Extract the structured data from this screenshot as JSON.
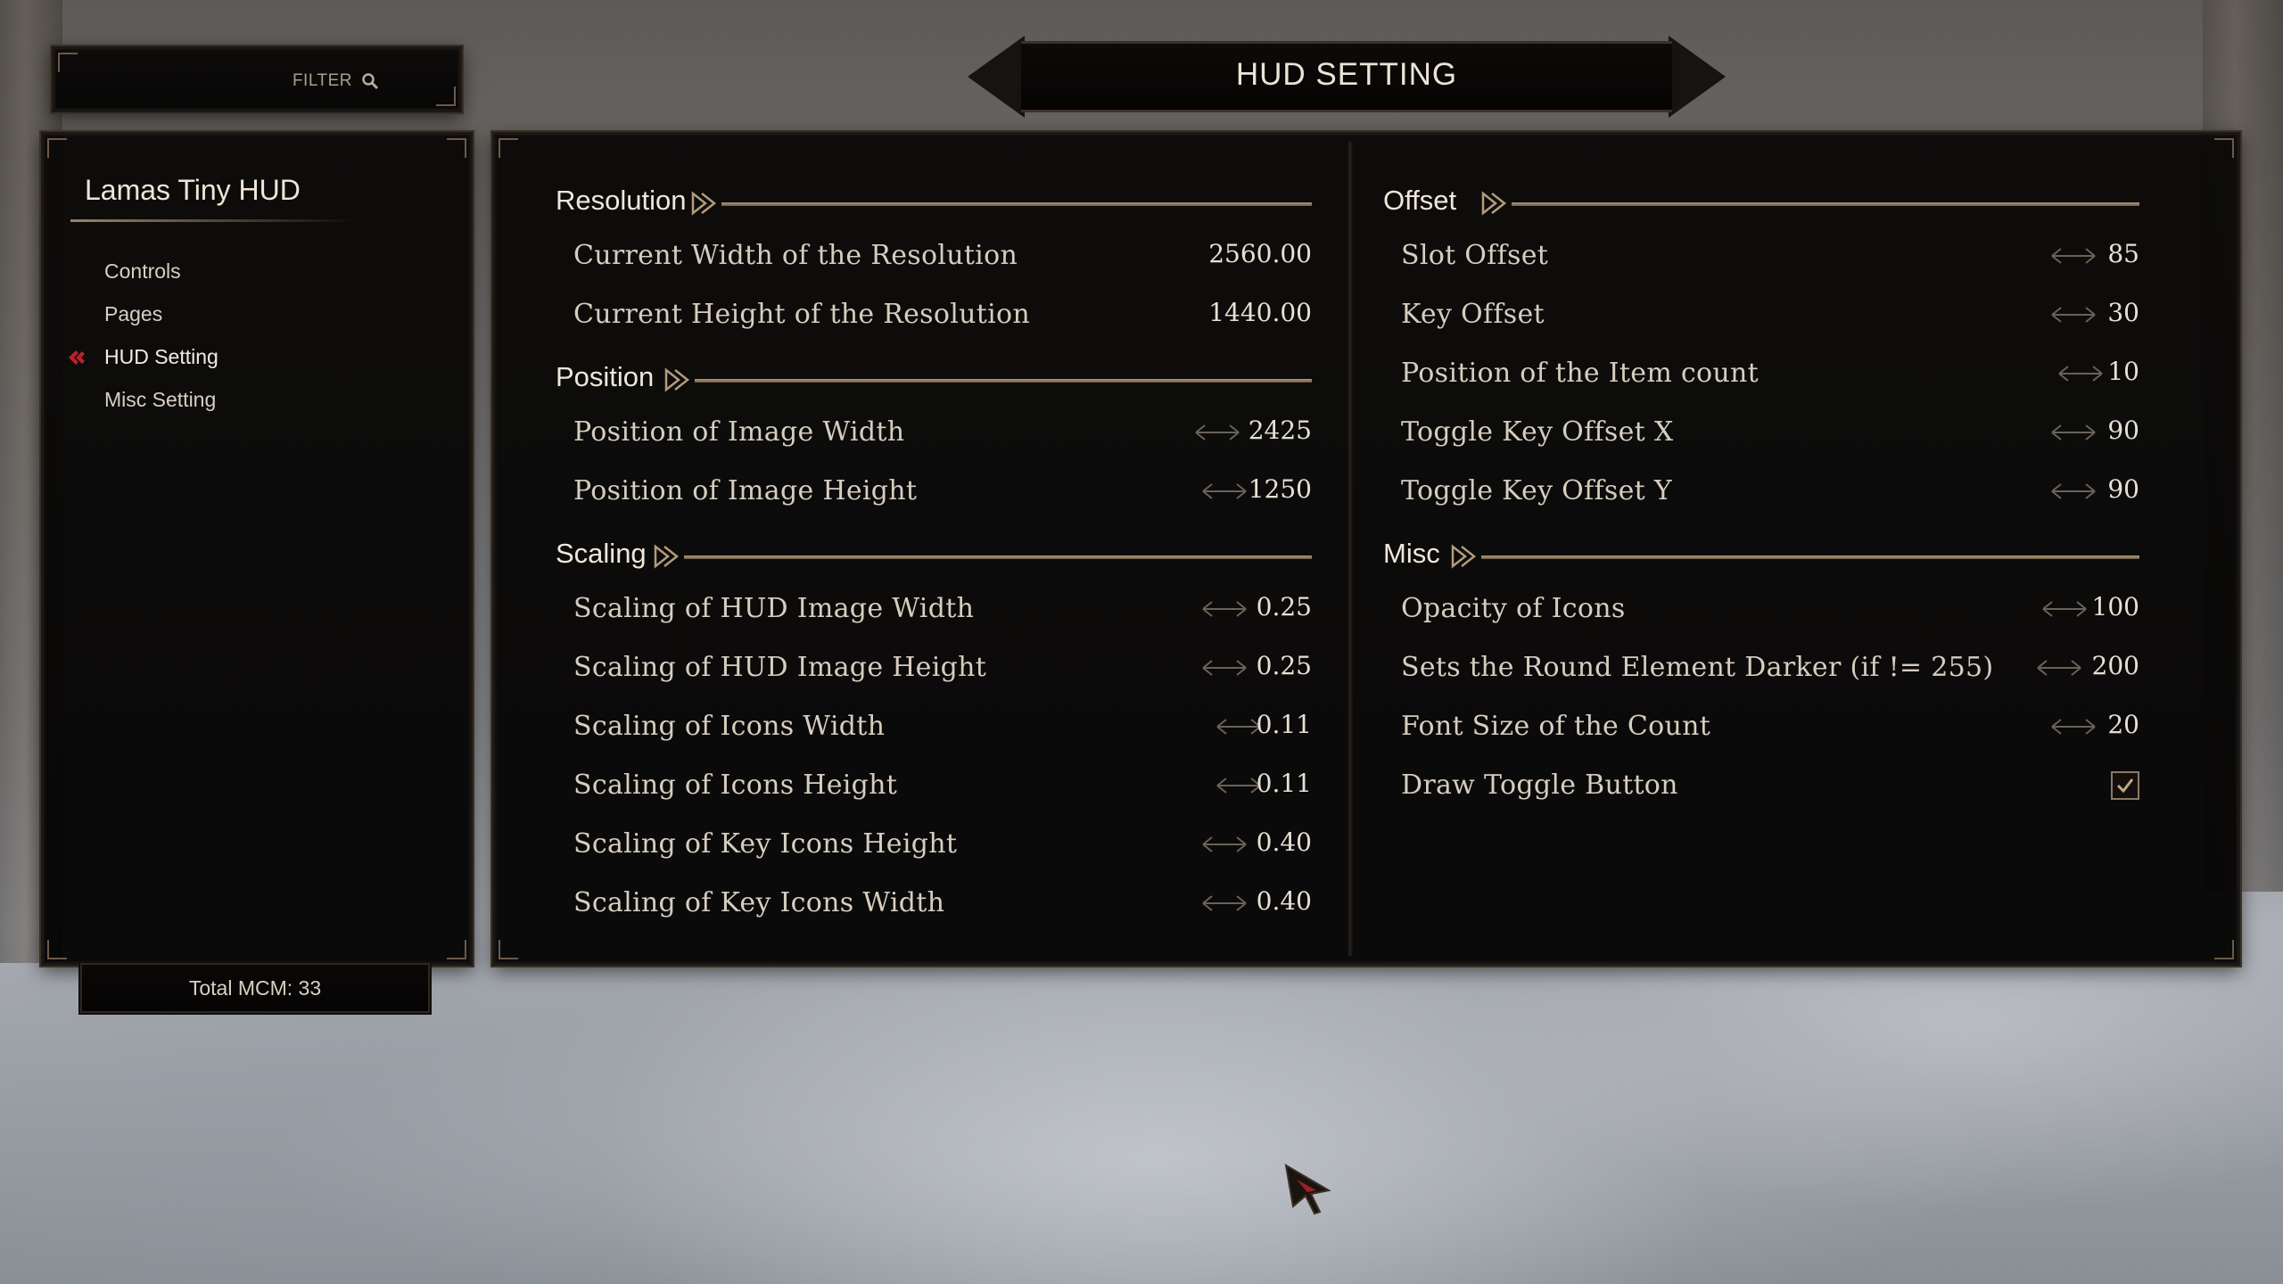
{
  "filter": {
    "label": "FILTER",
    "icon": "search-icon"
  },
  "header": {
    "title": "HUD SETTING"
  },
  "sidebar": {
    "mod_title": "Lamas Tiny HUD",
    "items": [
      {
        "label": "Controls",
        "active": false
      },
      {
        "label": "Pages",
        "active": false
      },
      {
        "label": "HUD Setting",
        "active": true
      },
      {
        "label": "Misc Setting",
        "active": false
      }
    ],
    "total": "Total MCM: 33"
  },
  "sections": {
    "resolution": {
      "title": "Resolution",
      "rows": [
        {
          "label": "Current Width of the Resolution",
          "value": "2560.00"
        },
        {
          "label": "Current Height of the Resolution",
          "value": "1440.00"
        }
      ]
    },
    "position": {
      "title": "Position",
      "rows": [
        {
          "label": "Position of Image Width",
          "value": "2425"
        },
        {
          "label": "Position of Image Height",
          "value": "1250"
        }
      ]
    },
    "scaling": {
      "title": "Scaling",
      "rows": [
        {
          "label": "Scaling of HUD Image Width",
          "value": "0.25"
        },
        {
          "label": "Scaling of HUD Image Height",
          "value": "0.25"
        },
        {
          "label": "Scaling of Icons Width",
          "value": "0.11"
        },
        {
          "label": "Scaling of Icons Height",
          "value": "0.11"
        },
        {
          "label": "Scaling of Key Icons Height",
          "value": "0.40"
        },
        {
          "label": "Scaling of Key Icons Width",
          "value": "0.40"
        }
      ]
    },
    "offset": {
      "title": "Offset",
      "rows": [
        {
          "label": "Slot Offset",
          "value": "85"
        },
        {
          "label": "Key Offset",
          "value": "30"
        },
        {
          "label": "Position of the Item count",
          "value": "10"
        },
        {
          "label": "Toggle Key Offset X",
          "value": "90"
        },
        {
          "label": "Toggle Key Offset Y",
          "value": "90"
        }
      ]
    },
    "misc": {
      "title": "Misc",
      "rows": [
        {
          "label": "Opacity of Icons",
          "value": "100"
        },
        {
          "label": "Sets the Round Element Darker (if != 255)",
          "value": "200"
        },
        {
          "label": "Font Size of the Count",
          "value": "20"
        },
        {
          "label": "Draw Toggle Button",
          "checked": true
        }
      ]
    }
  },
  "colors": {
    "accent_red": "#b8232a",
    "ornament": "#b39b7c",
    "panel": "#070605"
  }
}
